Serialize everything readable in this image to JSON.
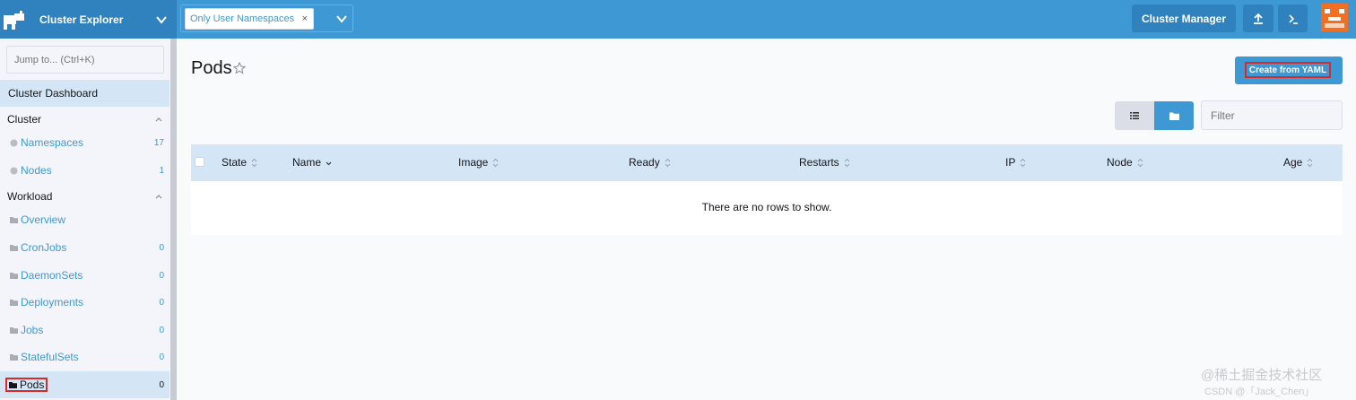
{
  "header": {
    "app_title": "Cluster Explorer",
    "namespace_chip": "Only User Namespaces",
    "namespace_chip_remove": "×",
    "cluster_manager": "Cluster Manager",
    "upload_icon": "upload-icon",
    "terminal_icon": "terminal-icon"
  },
  "sidebar": {
    "jump_placeholder": "Jump to... (Ctrl+K)",
    "dashboard": "Cluster Dashboard",
    "cluster_group": "Cluster",
    "cluster_items": [
      {
        "label": "Namespaces",
        "count": "17"
      },
      {
        "label": "Nodes",
        "count": "1"
      }
    ],
    "workload_group": "Workload",
    "workload_items": [
      {
        "label": "Overview",
        "count": ""
      },
      {
        "label": "CronJobs",
        "count": "0"
      },
      {
        "label": "DaemonSets",
        "count": "0"
      },
      {
        "label": "Deployments",
        "count": "0"
      },
      {
        "label": "Jobs",
        "count": "0"
      },
      {
        "label": "StatefulSets",
        "count": "0"
      },
      {
        "label": "Pods",
        "count": "0"
      }
    ]
  },
  "main": {
    "title": "Pods",
    "create_button": "Create from YAML",
    "filter_placeholder": "Filter",
    "columns": [
      "State",
      "Name",
      "Image",
      "Ready",
      "Restarts",
      "IP",
      "Node",
      "Age"
    ],
    "empty_message": "There are no rows to show."
  },
  "watermark": {
    "line1": "@稀土掘金技术社区",
    "line2": "CSDN @「Jack_Chen」"
  },
  "colors": {
    "header": "#3d98d3",
    "brand": "#2f82bd",
    "accent": "#3d98d3",
    "highlight": "#d52b2b",
    "selected_row": "#d4e6f6"
  }
}
